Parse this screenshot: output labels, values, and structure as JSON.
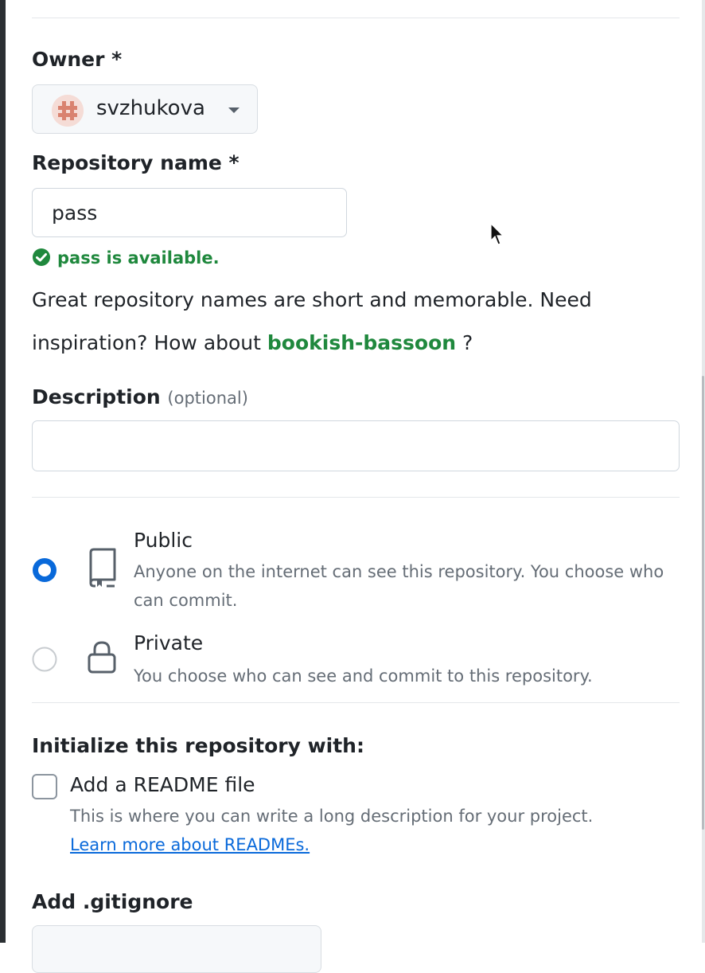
{
  "owner": {
    "label": "Owner *",
    "selected": "svzhukova"
  },
  "repository_name": {
    "label": "Repository name *",
    "value": "pass",
    "availability": "pass is available.",
    "hint_prefix": "Great repository names are short and memorable. Need",
    "hint_line2_prefix": "inspiration? How about",
    "suggestion": "bookish-bassoon",
    "hint_suffix": "?"
  },
  "description": {
    "label": "Description",
    "optional": "(optional)",
    "value": ""
  },
  "visibility": {
    "selected": "public",
    "options": [
      {
        "title": "Public",
        "description": "Anyone on the internet can see this repository. You choose who can commit."
      },
      {
        "title": "Private",
        "description": "You choose who can see and commit to this repository."
      }
    ]
  },
  "initialize": {
    "label": "Initialize this repository with:",
    "readme_label": "Add a README file",
    "readme_checked": false,
    "readme_description": "This is where you can write a long description for your project.",
    "readme_link": "Learn more about READMEs."
  },
  "gitignore": {
    "label": "Add .gitignore"
  },
  "colors": {
    "success": "#1f883d",
    "link": "#0969da",
    "radio_selected": "#0969da",
    "muted_text": "#656d76"
  },
  "icons": [
    "check-circle-icon",
    "repo-icon",
    "lock-icon",
    "caret-down-icon",
    "mouse-pointer-icon"
  ]
}
